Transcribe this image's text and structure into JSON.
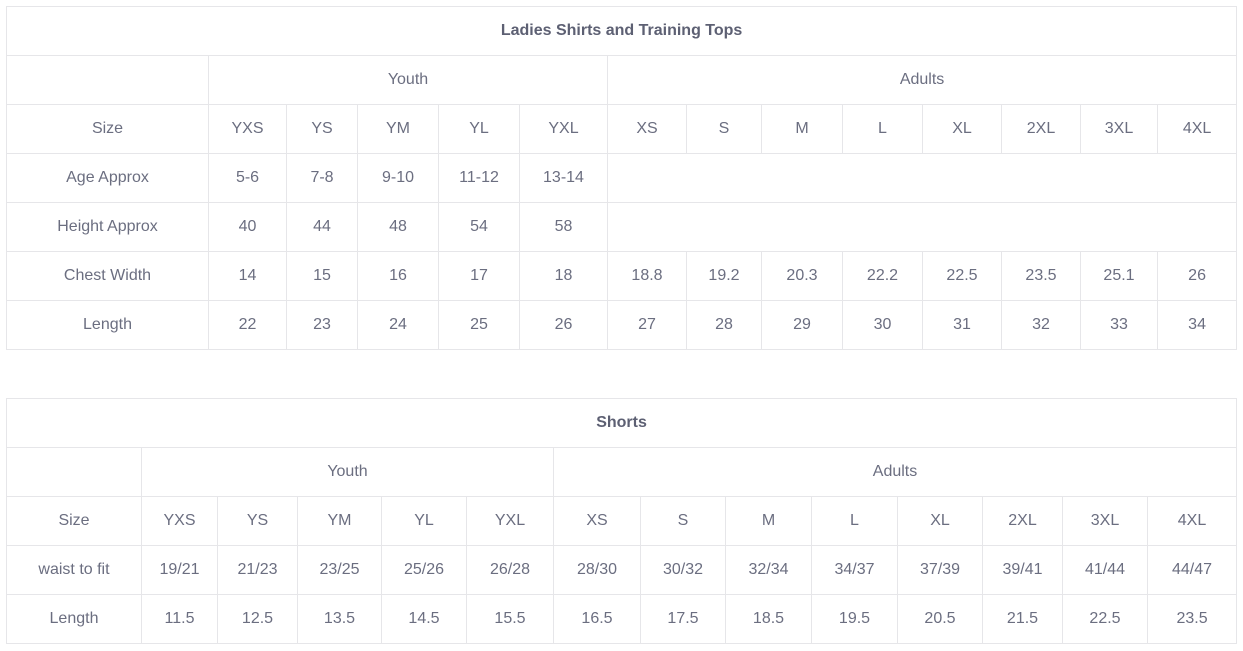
{
  "shirts": {
    "title": "Ladies Shirts and Training Tops",
    "group_youth": "Youth",
    "group_adults": "Adults",
    "size_label": "Size",
    "sizes": [
      "YXS",
      "YS",
      "YM",
      "YL",
      "YXL",
      "XS",
      "S",
      "M",
      "L",
      "XL",
      "2XL",
      "3XL",
      "4XL"
    ],
    "age_label": "Age Approx",
    "age": [
      "5-6",
      "7-8",
      "9-10",
      "11-12",
      "13-14"
    ],
    "height_label": "Height Approx",
    "height": [
      "40",
      "44",
      "48",
      "54",
      "58"
    ],
    "chest_label": "Chest Width",
    "chest": [
      "14",
      "15",
      "16",
      "17",
      "18",
      "18.8",
      "19.2",
      "20.3",
      "22.2",
      "22.5",
      "23.5",
      "25.1",
      "26"
    ],
    "length_label": "Length",
    "length": [
      "22",
      "23",
      "24",
      "25",
      "26",
      "27",
      "28",
      "29",
      "30",
      "31",
      "32",
      "33",
      "34"
    ]
  },
  "shorts": {
    "title": "Shorts",
    "group_youth": "Youth",
    "group_adults": "Adults",
    "size_label": "Size",
    "sizes": [
      "YXS",
      "YS",
      "YM",
      "YL",
      "YXL",
      "XS",
      "S",
      "M",
      "L",
      "XL",
      "2XL",
      "3XL",
      "4XL"
    ],
    "waist_label": "waist to fit",
    "waist": [
      "19/21",
      "21/23",
      "23/25",
      "25/26",
      "26/28",
      "28/30",
      "30/32",
      "32/34",
      "34/37",
      "37/39",
      "39/41",
      "41/44",
      "44/47"
    ],
    "length_label": "Length",
    "length": [
      "11.5",
      "12.5",
      "13.5",
      "14.5",
      "15.5",
      "16.5",
      "17.5",
      "18.5",
      "19.5",
      "20.5",
      "21.5",
      "22.5",
      "23.5"
    ]
  }
}
